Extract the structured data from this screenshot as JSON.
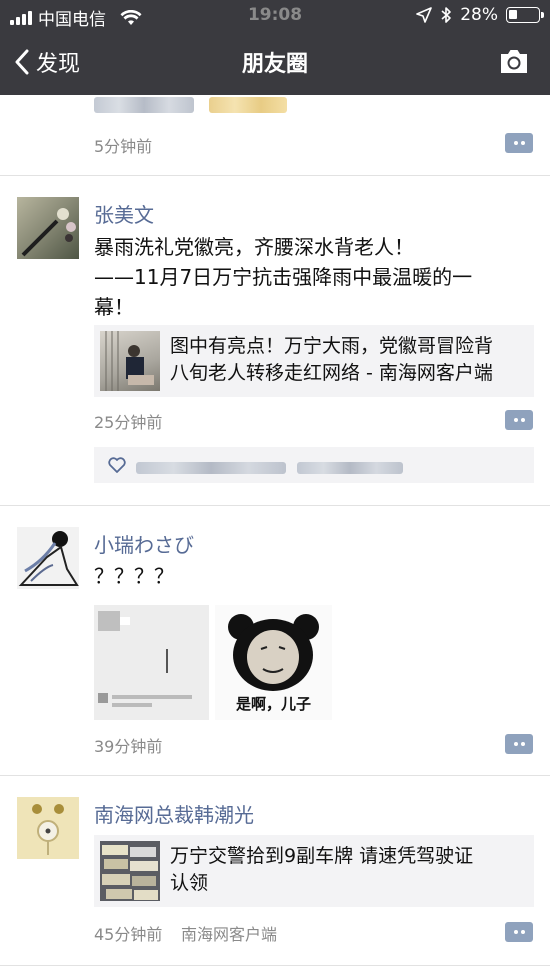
{
  "status_bar": {
    "carrier": "中国电信",
    "time": "19:08",
    "battery": "28%",
    "battery_level": 0.28
  },
  "nav": {
    "back_label": "发现",
    "title": "朋友圈"
  },
  "posts": [
    {
      "time": "5分钟前"
    },
    {
      "nickname": "张美文",
      "text_lines": [
        "暴雨洗礼党徽亮，齐腰深水背老人！",
        "——11月7日万宁抗击强降雨中最温暖的一",
        "幕！"
      ],
      "link": {
        "lines": [
          "图中有亮点！万宁大雨，党徽哥冒险背",
          "八旬老人转移走红网络 - 南海网客户端"
        ]
      },
      "time": "25分钟前"
    },
    {
      "nickname": "小瑞わさび",
      "text": "？？？？",
      "meme_caption": "是啊，儿子",
      "time": "39分钟前"
    },
    {
      "nickname": "南海网总裁韩潮光",
      "link": {
        "lines": [
          "万宁交警拾到9副车牌 请速凭驾驶证",
          "认领"
        ]
      },
      "time": "45分钟前",
      "source": "南海网客户端"
    }
  ],
  "colors": {
    "nav_bg": "#3a3a3f",
    "nickname": "#576b95",
    "time": "#8a8a8a",
    "card_bg": "#f3f3f5"
  }
}
